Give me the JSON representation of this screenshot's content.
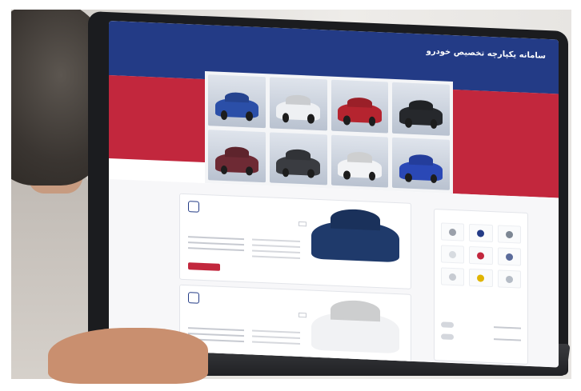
{
  "site": {
    "title": "سامانه یکپارچه تخصیص خودرو",
    "subtitle": "",
    "nav": [
      "",
      "",
      ""
    ]
  },
  "colors": {
    "header_blue": "#233b86",
    "accent_red": "#c2273d",
    "page_bg": "#f7f7f9"
  },
  "gallery": {
    "cars": [
      {
        "name": "car-blue-suv",
        "color": "#2b4fa8"
      },
      {
        "name": "car-white-sedan",
        "color": "#eef0f3"
      },
      {
        "name": "car-red-suv",
        "color": "#b5242f"
      },
      {
        "name": "car-black-suv",
        "color": "#26282c"
      },
      {
        "name": "car-maroon-suv",
        "color": "#6e2a34"
      },
      {
        "name": "car-dark-sedan",
        "color": "#3a3c41"
      },
      {
        "name": "car-white-hatch",
        "color": "#f2f3f5"
      },
      {
        "name": "car-blue-crossover",
        "color": "#2a48b6"
      }
    ]
  },
  "listings": [
    {
      "title": "",
      "button": "",
      "car_color": "#1f3a6b"
    },
    {
      "title": "",
      "button": "",
      "car_color": "#f1f2f4"
    }
  ],
  "sidebar": {
    "title": "",
    "brand_colors": [
      "#9aa0aa",
      "#233b86",
      "#7d8794",
      "#d7dbe0",
      "#c2273d",
      "#5a6b9a",
      "#c7cbd2",
      "#e0b400",
      "#b5bcc6"
    ]
  }
}
